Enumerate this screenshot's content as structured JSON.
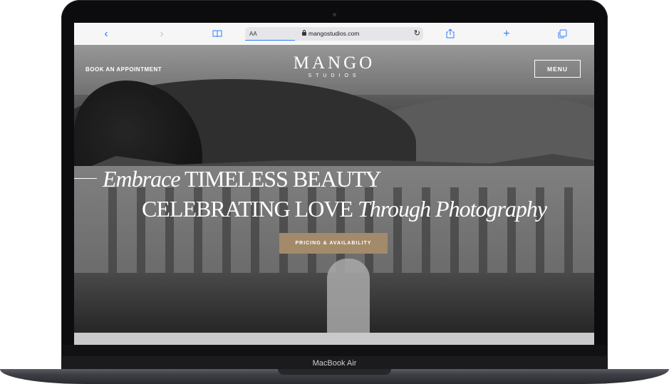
{
  "browser": {
    "back_icon": "‹",
    "forward_icon": "›",
    "url_aa": "AA",
    "url": "mangostudios.com",
    "reload_icon": "↻",
    "bookmarks_icon": "book-icon",
    "share_icon": "share-icon",
    "new_tab_icon": "+",
    "tabs_icon": "tabs-icon"
  },
  "site": {
    "book_label": "BOOK AN APPOINTMENT",
    "logo_main": "MANGO",
    "logo_sub": "STUDIOS",
    "menu_label": "MENU",
    "headline1_italic": "Embrace",
    "headline1_rest": "TIMELESS BEAUTY",
    "headline2_main": "CELEBRATING LOVE",
    "headline2_italic": "Through Photography",
    "cta_label": "PRICING & AVAILABILITY",
    "accent": "#a38a6a"
  },
  "device": {
    "label": "MacBook Air"
  }
}
